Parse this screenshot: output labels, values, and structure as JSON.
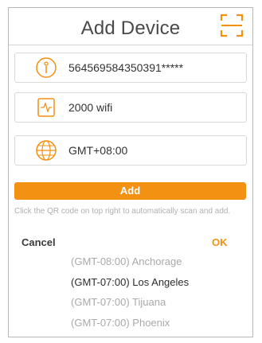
{
  "header": {
    "title": "Add Device"
  },
  "fields": {
    "serial": {
      "icon": "serial-number-icon",
      "value": "564569584350391*****"
    },
    "wifi": {
      "icon": "wifi-network-icon",
      "value": "2000 wifi"
    },
    "timezone": {
      "icon": "globe-icon",
      "value": "GMT+08:00"
    }
  },
  "add_button": {
    "label": "Add"
  },
  "hint": "Click the QR code on top right to automatically scan and add.",
  "picker": {
    "cancel_label": "Cancel",
    "ok_label": "OK",
    "options": [
      "(GMT-08:00) Anchorage",
      "(GMT-07:00) Los Angeles",
      "(GMT-07:00) Tijuana",
      "(GMT-07:00) Phoenix"
    ],
    "selected": "(GMT-07:00) Los Angeles"
  },
  "colors": {
    "accent": "#f29112",
    "border": "#d9d9d9",
    "muted_text": "#a9a9a9"
  }
}
